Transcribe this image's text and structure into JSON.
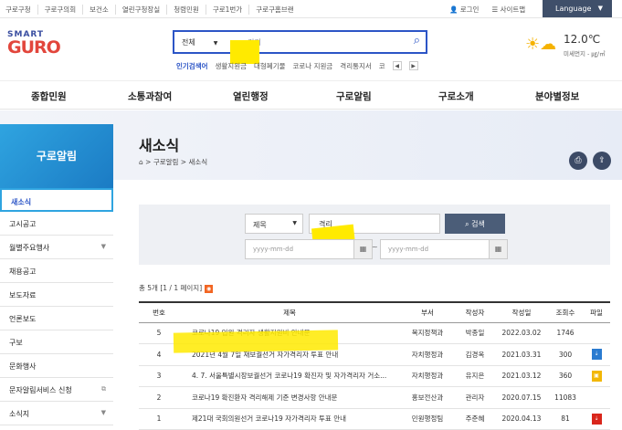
{
  "top_links": [
    "구로구청",
    "구로구의회",
    "보건소",
    "열린구청장실",
    "청렴민원",
    "구로1번가",
    "구로구홈브랜"
  ],
  "util": {
    "login": "로그인",
    "sitemap": "사이트맵"
  },
  "language": "Language",
  "logo": {
    "smart": "SMART",
    "guro": "GURO"
  },
  "search": {
    "category": "전체",
    "query": "격리"
  },
  "keywords": [
    "인기검색어",
    "생활지원금",
    "대형폐기물",
    "코로나 지원금",
    "격리통지서",
    "코"
  ],
  "weather": {
    "temp": "12.0℃",
    "dust": "미세먼지 - ㎍/㎥"
  },
  "gnb": [
    "종합민원",
    "소통과참여",
    "열린행정",
    "구로알림",
    "구로소개",
    "분야별정보"
  ],
  "side_title": "구로알림",
  "page_title": "새소식",
  "breadcrumb": "⌂ > 구로알림 > 새소식",
  "side_nav": [
    "새소식",
    "고시공고",
    "월별주요행사",
    "채용공고",
    "보도자료",
    "언론보도",
    "구보",
    "문화행사",
    "문자알림서비스 신청",
    "소식지"
  ],
  "filter": {
    "field": "제목",
    "query": "격리",
    "button": "검색",
    "date_placeholder": "yyyy-mm-dd"
  },
  "count_text": "총 5개 [1 / 1 페이지]",
  "table": {
    "headers": [
      "번호",
      "제목",
      "부서",
      "작성자",
      "작성일",
      "조회수",
      "파일"
    ],
    "rows": [
      {
        "no": "5",
        "title": "코로나19 입원 격리자 생활지원비 안내문",
        "dept": "복지정책과",
        "author": "박종일",
        "date": "2022.03.02",
        "views": "1746",
        "file": ""
      },
      {
        "no": "4",
        "title": "2021년 4월 7일 재보궐선거 자가격리자 투표 안내",
        "dept": "자치행정과",
        "author": "김경옥",
        "date": "2021.03.31",
        "views": "300",
        "file": "hwp"
      },
      {
        "no": "3",
        "title": "4. 7. 서울특별시장보궐선거 코로나19 확진자 및 자가격리자 거소...",
        "dept": "자치행정과",
        "author": "유지은",
        "date": "2021.03.12",
        "views": "360",
        "file": "zip"
      },
      {
        "no": "2",
        "title": "코로나19 확진환자 격리해제 기준 변경사항 안내문",
        "dept": "홍보전산과",
        "author": "관리자",
        "date": "2020.07.15",
        "views": "11083",
        "file": ""
      },
      {
        "no": "1",
        "title": "제21대 국회의원선거 코로나19 자가격리자 투표 안내",
        "dept": "민원행정팀",
        "author": "주준혜",
        "date": "2020.04.13",
        "views": "81",
        "file": "pdf"
      }
    ]
  }
}
